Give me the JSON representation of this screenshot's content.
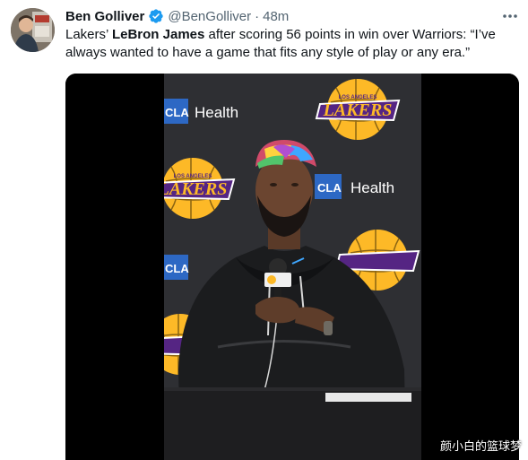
{
  "author": {
    "name": "Ben Golliver",
    "handle": "@BenGolliver",
    "separator": "·",
    "time": "48m"
  },
  "tweet": {
    "segments": [
      {
        "text": "Lakers’ ",
        "bold": false
      },
      {
        "text": "LeBron James",
        "bold": true
      },
      {
        "text": " after scoring 56 points in win over Warriors: “I’ve always wanted to have a game that fits any style of play or any era.”",
        "bold": false
      }
    ]
  },
  "media": {
    "backdrop_text": {
      "cla": "CLA",
      "health": "Health",
      "los_angeles": "LOS ANGELES",
      "lakers": "LAKERS"
    }
  },
  "watermark": "颜小白的篮球梦",
  "colors": {
    "verified": "#1d9bf0",
    "text": "#0f1419",
    "muted": "#536471",
    "lakers_gold": "#fdb927",
    "lakers_purple": "#552583",
    "ucla_blue": "#2d68c4"
  }
}
